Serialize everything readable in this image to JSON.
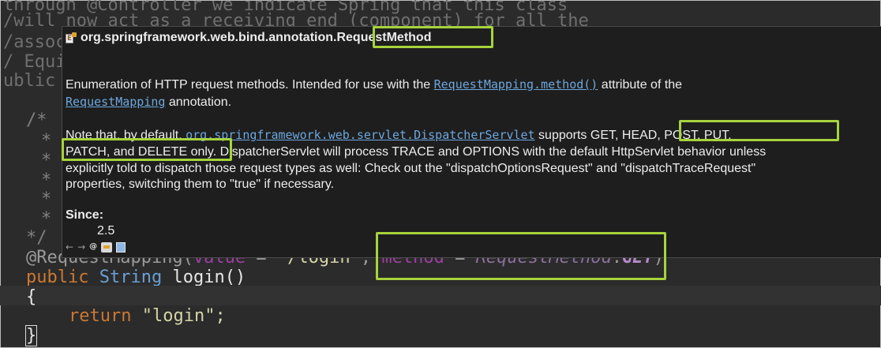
{
  "editor": {
    "faded_comment_lines": [
      "through @Controller we indicate Spring that this class",
      "/will now act as a receiving end (component) for all the",
      "/assoc",
      "/ Equiv",
      "ublic c"
    ],
    "comment_stubs": [
      "/*",
      "* /",
      "*",
      "*",
      "* ,",
      "* r",
      "*/"
    ],
    "annotation_line": {
      "annotation": "@RequestMapping(",
      "value_kw": "value",
      "eq1": " = ",
      "path": "\"/login\"",
      "comma": ", ",
      "method_kw": "method",
      "eq2": " = ",
      "enum_type": "RequestMethod",
      "dot": ".",
      "enum_const": "GET",
      "close": ")"
    },
    "signature": {
      "public": "public",
      "type": "String",
      "method": "login()"
    },
    "brace_open": "{",
    "return_kw": "return",
    "return_value": "\"login\";",
    "brace_close": "}"
  },
  "popup": {
    "icon": "enum-class-icon",
    "package": "org.springframework.web.bind.annotation.",
    "class_name": "RequestMethod",
    "p1_text_a": "Enumeration of HTTP request methods. Intended for use with the ",
    "p1_link_a": "RequestMapping.method()",
    "p1_text_b": " attribute of the",
    "p1_link_b": "RequestMapping",
    "p1_text_c": " annotation.",
    "p2_text_a": "Note that, by default, ",
    "p2_link": "org.springframework.web.servlet.DispatcherServlet",
    "p2_text_b": " supports ",
    "p2_methods_a": "GET, HEAD, POST, PUT,",
    "p2_methods_b": "PATCH, and DELETE only.",
    "p2_text_c": " DispatcherServlet will process TRACE and OPTIONS with the default HttpServlet behavior unless",
    "p2_text_d": "explicitly told to dispatch those request types as well: Check out the \"dispatchOptionsRequest\" and \"dispatchTraceRequest\"",
    "p2_text_e": "properties, switching them to \"true\" if necessary.",
    "since_label": "Since:",
    "since_value": "2.5",
    "toolbar": {
      "back": "←",
      "forward": "→",
      "at": "@",
      "icons": [
        "back-arrow-icon",
        "forward-arrow-icon",
        "attached-javadoc-icon",
        "open-declaration-icon",
        "open-in-browser-icon"
      ]
    }
  },
  "colors": {
    "highlight": "#a6d33c",
    "background": "#2b2b2b",
    "popup_background": "#1e1e1e",
    "link": "#6ca7df"
  }
}
